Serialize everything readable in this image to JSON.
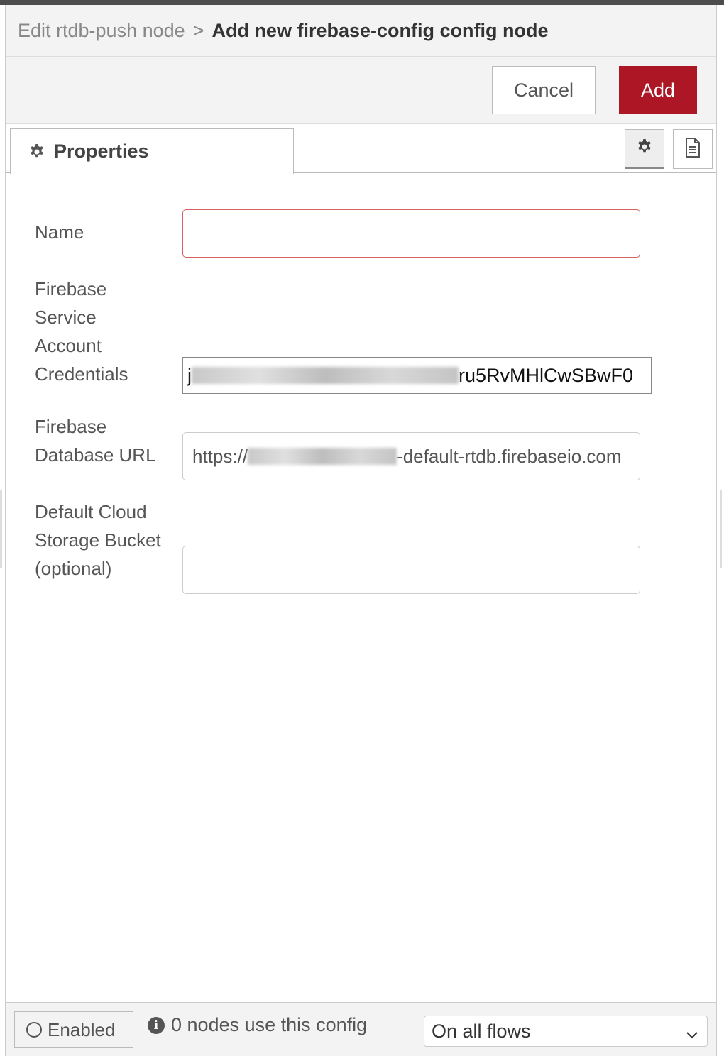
{
  "header": {
    "breadcrumb": "Edit rtdb-push node",
    "separator": ">",
    "title": "Add new firebase-config config node"
  },
  "toolbar": {
    "cancel_label": "Cancel",
    "add_label": "Add",
    "add_color": "#ad1625"
  },
  "tabs": {
    "properties_label": "Properties",
    "properties_icon": "gear-icon",
    "settings_icon": "gear-icon",
    "description_icon": "document-icon"
  },
  "form": {
    "name_label": "Name",
    "name_value": "",
    "credentials_label_lines": [
      "Firebase",
      "Service",
      "Account",
      "Credentials"
    ],
    "credentials_value_prefix": "j",
    "credentials_value_suffix": "ru5RvMHlCwSBwF0",
    "db_url_label_lines": [
      "Firebase",
      "Database URL"
    ],
    "db_url_value_prefix": "https://",
    "db_url_value_suffix": "-default-rtdb.firebaseio.com",
    "bucket_label_lines": [
      "Default Cloud",
      "Storage Bucket",
      "(optional)"
    ],
    "bucket_value": ""
  },
  "footer": {
    "enabled_label": "Enabled",
    "usage_text": "0 nodes use this config",
    "scope_selected": "On all flows"
  }
}
